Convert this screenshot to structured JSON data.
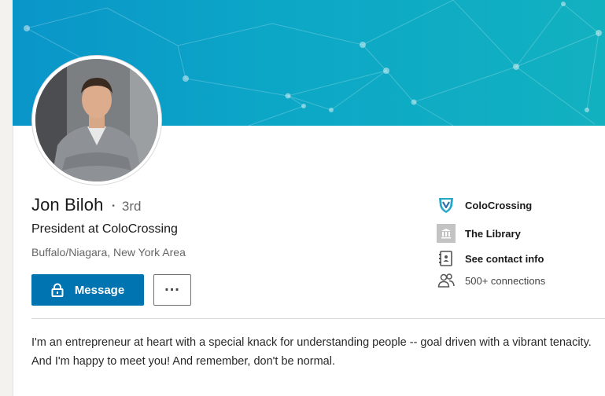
{
  "profile": {
    "name": "Jon Biloh",
    "degree_separator": "•",
    "degree": "3rd",
    "headline": "President at ColoCrossing",
    "location": "Buffalo/Niagara, New York Area"
  },
  "actions": {
    "message_label": "Message",
    "more_label": "..."
  },
  "sidebar": {
    "items": [
      {
        "label": "ColoCrossing",
        "icon": "colocrossing-logo-icon"
      },
      {
        "label": "The Library",
        "icon": "school-icon"
      },
      {
        "label": "See contact info",
        "icon": "contact-card-icon"
      },
      {
        "label": "500+ connections",
        "icon": "connections-icon"
      }
    ]
  },
  "summary": "I'm an entrepreneur at heart with a special knack for understanding people -- goal driven with a vibrant tenacity. And I'm happy to meet you! And remember, don't be normal.",
  "colors": {
    "primary_button": "#0073b1",
    "banner_start": "#0a95c9",
    "banner_end": "#12b1c0"
  }
}
